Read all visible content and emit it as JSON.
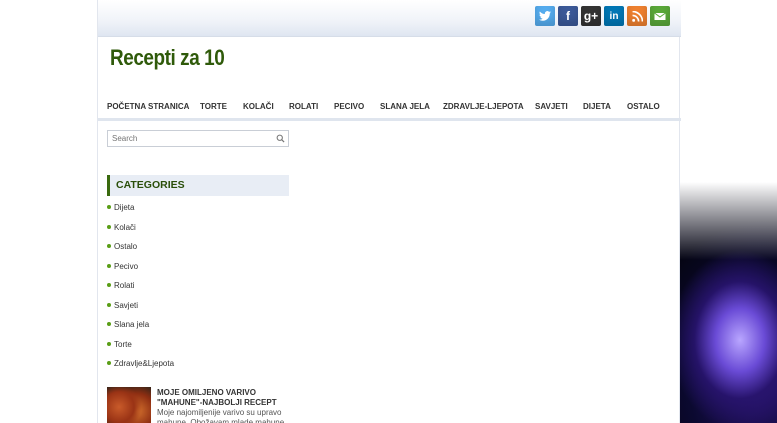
{
  "site": {
    "title": "Recepti za 10"
  },
  "social": [
    {
      "name": "twitter-icon",
      "glyph": "t"
    },
    {
      "name": "facebook-icon",
      "glyph": "f"
    },
    {
      "name": "google-plus-icon",
      "glyph": "g+"
    },
    {
      "name": "linkedin-icon",
      "glyph": "in"
    },
    {
      "name": "rss-icon",
      "glyph": ""
    },
    {
      "name": "email-icon",
      "glyph": ""
    }
  ],
  "nav": [
    "POČETNA STRANICA",
    "TORTE",
    "KOLAČI",
    "ROLATI",
    "PECIVO",
    "SLANA JELA",
    "ZDRAVLJE-LJEPOTA",
    "SAVJETI",
    "DIJETA",
    "OSTALO"
  ],
  "search": {
    "placeholder": "Search"
  },
  "categories": {
    "title": "CATEGORIES",
    "items": [
      "Dijeta",
      "Kolači",
      "Ostalo",
      "Pecivo",
      "Rolati",
      "Savjeti",
      "Slana jela",
      "Torte",
      "Zdravlje&Ljepota"
    ]
  },
  "post": {
    "title": "MOJE OMILJENO VARIVO \"MAHUNE\"-NAJBOLJI RECEPT",
    "excerpt": "Moje najomiljenije varivo su upravo mahune. Obožavam mlade mahune"
  },
  "colors": {
    "title_green": "#2f5a0a",
    "bullet_green": "#5a9e16",
    "category_bg": "#e8edf5"
  }
}
